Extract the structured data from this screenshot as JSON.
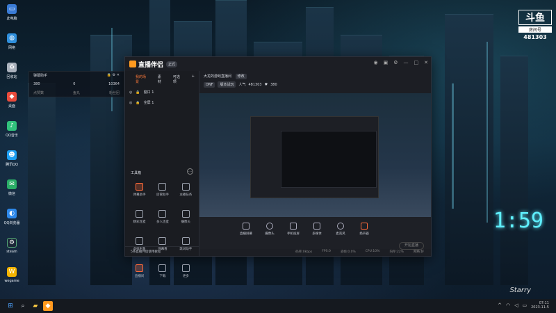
{
  "desktop": {
    "icons": [
      {
        "label": "此电脑",
        "icon": "computer-icon",
        "color": "#3a7bd5"
      },
      {
        "label": "网络",
        "icon": "network-icon",
        "color": "#2f8fdc"
      },
      {
        "label": "回收站",
        "icon": "recycle-bin-icon",
        "color": "#aab2bd"
      },
      {
        "label": "桌面",
        "icon": "desktop-icon",
        "color": "#e94b3c"
      },
      {
        "label": "QQ音乐",
        "icon": "qq-music-icon",
        "color": "#31c27c"
      },
      {
        "label": "腾讯QQ",
        "icon": "qq-icon",
        "color": "#1d9ff2"
      },
      {
        "label": "微信",
        "icon": "wechat-icon",
        "color": "#2aae67"
      },
      {
        "label": "QQ浏览器",
        "icon": "qq-browser-icon",
        "color": "#2d88ea"
      },
      {
        "label": "steam",
        "icon": "steam-icon",
        "color": "#1b2838"
      },
      {
        "label": "wegame",
        "icon": "wegame-icon",
        "color": "#f4b400"
      }
    ]
  },
  "danmu_panel": {
    "title": "弹幕助手",
    "controls": "🔒 ⚙ ✕",
    "stats": [
      "380",
      "0",
      "10364"
    ],
    "labels": [
      "点赞数",
      "鱼丸",
      "粉丝团"
    ]
  },
  "brand": {
    "logo": "斗鱼",
    "room_label": "房间号",
    "room_id": "481303"
  },
  "app": {
    "name": "直播伴侣",
    "version_badge": "正式",
    "left_tabs": [
      "我的场景",
      "素材",
      "可选项"
    ],
    "scenes": [
      "窗口 1",
      "全屏 1"
    ],
    "tools_title": "工具箱",
    "tools": [
      {
        "label": "弹幕助手",
        "hot": true
      },
      {
        "label": "房管助手",
        "hot": false
      },
      {
        "label": "主播任务",
        "hot": false
      },
      {
        "label": "精彩连麦",
        "hot": false
      },
      {
        "label": "多人连麦",
        "hot": false
      },
      {
        "label": "摄像头",
        "hot": false
      },
      {
        "label": "虚拟形象",
        "hot": false
      },
      {
        "label": "弹幕看",
        "hot": false
      },
      {
        "label": "歌词助手",
        "hot": false
      },
      {
        "label": "直播间",
        "hot": false
      },
      {
        "label": "下载",
        "hot": false
      },
      {
        "label": "更多",
        "hot": false
      }
    ],
    "footer": "5条直播伴侣使用教程",
    "room_title": "大龙的游戏直播间",
    "room_tag": "修改",
    "tags": [
      "DNF",
      "版本试玩"
    ],
    "popularity_label": "人气",
    "popularity": "481303",
    "fans": "380",
    "controls": [
      {
        "label": "直播屏幕",
        "icon": "screen-share-icon"
      },
      {
        "label": "摄像头",
        "icon": "camera-icon"
      },
      {
        "label": "手机投屏",
        "icon": "phone-cast-icon"
      },
      {
        "label": "多媒体",
        "icon": "media-icon"
      },
      {
        "label": "麦克风",
        "icon": "microphone-icon"
      },
      {
        "label": "扬声器",
        "icon": "speaker-icon"
      }
    ],
    "go_live": "开始直播",
    "status": [
      "码率:0kbps",
      "FPS:0",
      "丢帧:0.0%",
      "CPU:10%",
      "内存:22%",
      "网络:好"
    ]
  },
  "overlay_clock": "1:59",
  "signature": "Starry",
  "taskbar": {
    "time": "07:11",
    "date": "2023-11-5"
  }
}
